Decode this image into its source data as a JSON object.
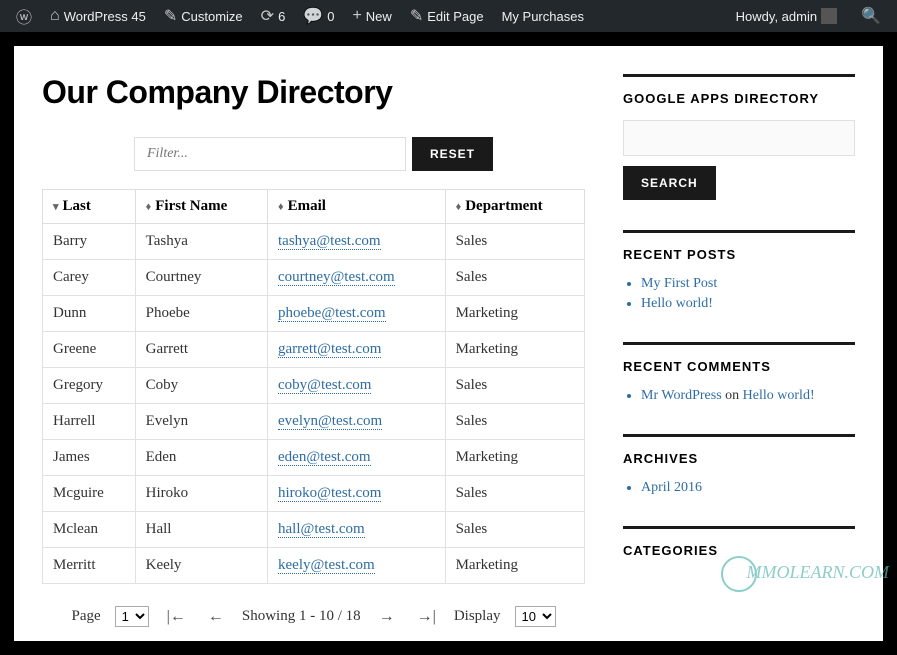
{
  "adminbar": {
    "site": "WordPress 45",
    "customize": "Customize",
    "updates": "6",
    "comments": "0",
    "new": "New",
    "edit": "Edit Page",
    "purchases": "My Purchases",
    "howdy": "Howdy, admin"
  },
  "page_title": "Our Company Directory",
  "filter": {
    "placeholder": "Filter...",
    "reset": "RESET"
  },
  "columns": {
    "last": "Last",
    "first": "First Name",
    "email": "Email",
    "dept": "Department"
  },
  "rows": [
    {
      "last": "Barry",
      "first": "Tashya",
      "email": "tashya@test.com",
      "dept": "Sales"
    },
    {
      "last": "Carey",
      "first": "Courtney",
      "email": "courtney@test.com",
      "dept": "Sales"
    },
    {
      "last": "Dunn",
      "first": "Phoebe",
      "email": "phoebe@test.com",
      "dept": "Marketing"
    },
    {
      "last": "Greene",
      "first": "Garrett",
      "email": "garrett@test.com",
      "dept": "Marketing"
    },
    {
      "last": "Gregory",
      "first": "Coby",
      "email": "coby@test.com",
      "dept": "Sales"
    },
    {
      "last": "Harrell",
      "first": "Evelyn",
      "email": "evelyn@test.com",
      "dept": "Sales"
    },
    {
      "last": "James",
      "first": "Eden",
      "email": "eden@test.com",
      "dept": "Marketing"
    },
    {
      "last": "Mcguire",
      "first": "Hiroko",
      "email": "hiroko@test.com",
      "dept": "Sales"
    },
    {
      "last": "Mclean",
      "first": "Hall",
      "email": "hall@test.com",
      "dept": "Sales"
    },
    {
      "last": "Merritt",
      "first": "Keely",
      "email": "keely@test.com",
      "dept": "Marketing"
    }
  ],
  "pager": {
    "page_label": "Page",
    "page_val": "1",
    "showing": "Showing  1 - 10 / 18",
    "display_label": "Display",
    "display_val": "10"
  },
  "sidebar": {
    "widgets": {
      "gapps": {
        "title": "GOOGLE APPS DIRECTORY",
        "search": "SEARCH"
      },
      "recent_posts": {
        "title": "RECENT POSTS",
        "items": [
          "My First Post",
          "Hello world!"
        ]
      },
      "recent_comments": {
        "title": "RECENT COMMENTS",
        "items": [
          {
            "author": "Mr WordPress",
            "on": " on ",
            "post": "Hello world!"
          }
        ]
      },
      "archives": {
        "title": "ARCHIVES",
        "items": [
          "April 2016"
        ]
      },
      "categories": {
        "title": "CATEGORIES"
      }
    }
  },
  "watermark": "MMOLEARN.COM"
}
